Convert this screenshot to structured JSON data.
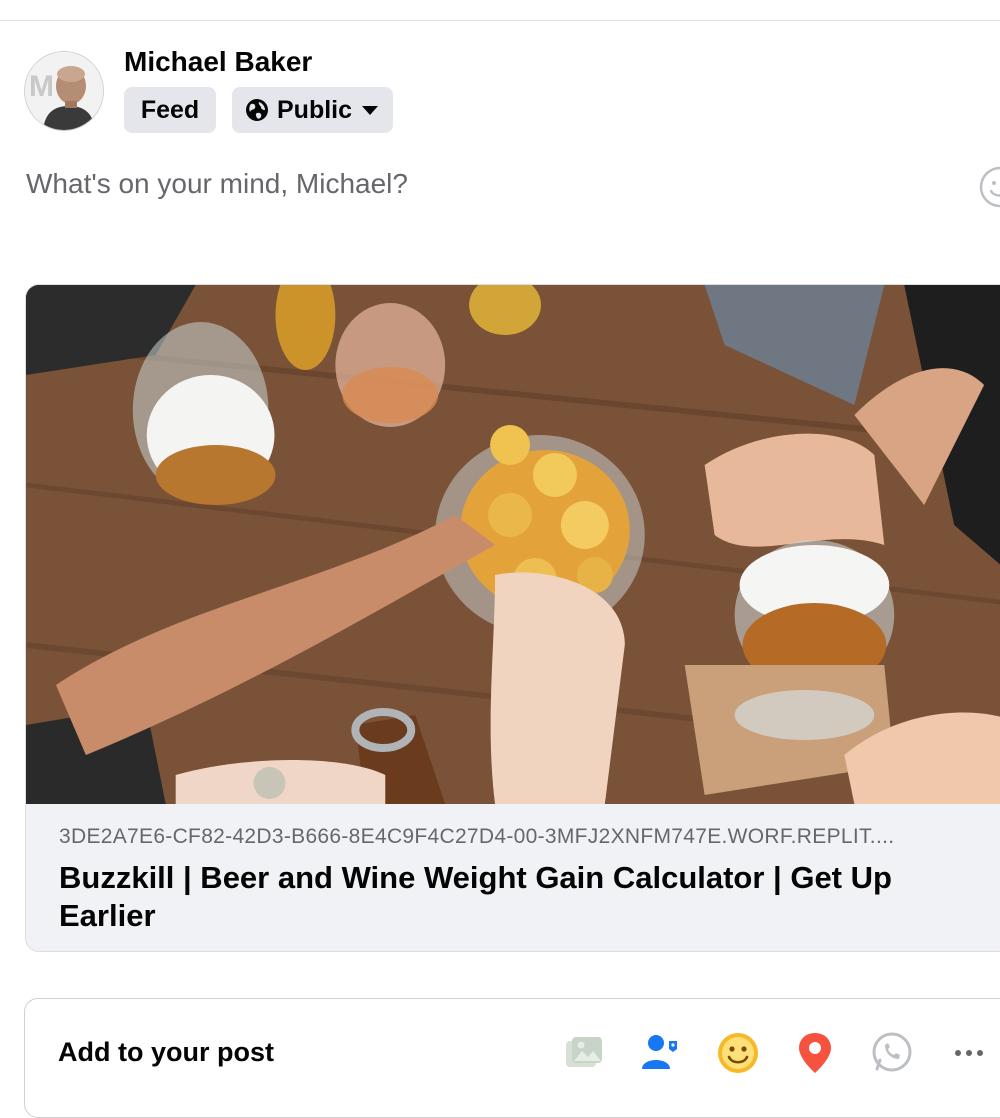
{
  "post_header": {
    "author_name": "Michael Baker",
    "audience_feed": "Feed",
    "audience_privacy": "Public"
  },
  "composer": {
    "placeholder": "What's on your mind, Michael?"
  },
  "link_preview": {
    "domain": "3DE2A7E6-CF82-42D3-B666-8E4C9F4C27D4-00-3MFJ2XNFM747E.WORF.REPLIT....",
    "title": "Buzzkill | Beer and Wine Weight Gain Calculator | Get Up Earlier"
  },
  "add_to_post": {
    "label": "Add to your post",
    "icons": [
      "photo-video-icon",
      "tag-people-icon",
      "feeling-icon",
      "check-in-icon",
      "whatsapp-icon",
      "more-icon"
    ]
  },
  "colors": {
    "pill_bg": "#e4e6eb",
    "secondary_text": "#65676b",
    "card_bg": "#f0f2f5",
    "tag_blue": "#1877f2",
    "feeling_yellow": "#f7b928",
    "checkin_red": "#f5533d",
    "photo_green_muted": "#c8d7c8"
  }
}
